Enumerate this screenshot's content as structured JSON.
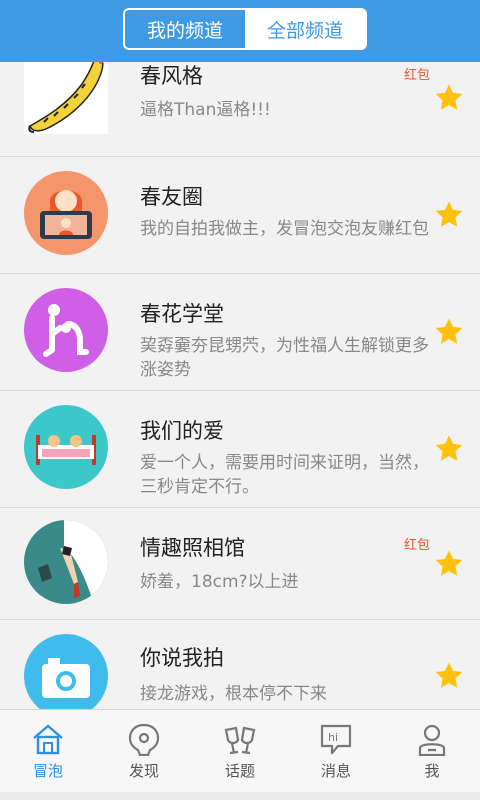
{
  "header": {
    "tabs": [
      {
        "label": "我的频道"
      },
      {
        "label": "全部频道"
      }
    ]
  },
  "channels": [
    {
      "title": "春风格",
      "desc": "逼格Than逼格!!!",
      "tag": "红包",
      "icon": "banana-image"
    },
    {
      "title": "春友圈",
      "desc": "我的自拍我做主，发冒泡交泡友赚红包",
      "tag": "",
      "icon": "selfie-icon"
    },
    {
      "title": "春花学堂",
      "desc": "巭孬嫑夯昆甥茓，为性福人生解锁更多涨姿势",
      "tag": "",
      "icon": "figure-icon"
    },
    {
      "title": "我们的爱",
      "desc": "爱一个人，需要用时间来证明，当然，三秒肯定不行。",
      "tag": "",
      "icon": "bed-icon"
    },
    {
      "title": "情趣照相馆",
      "desc": "娇羞，18cm?以上进",
      "tag": "红包",
      "icon": "legs-icon"
    },
    {
      "title": "你说我拍",
      "desc": "接龙游戏，根本停不下来",
      "tag": "",
      "icon": "camera-icon"
    }
  ],
  "tabbar": {
    "items": [
      {
        "label": "冒泡",
        "icon": "home-icon"
      },
      {
        "label": "发现",
        "icon": "discover-icon"
      },
      {
        "label": "话题",
        "icon": "cheers-icon"
      },
      {
        "label": "消息",
        "icon": "message-icon"
      },
      {
        "label": "我",
        "icon": "profile-icon"
      }
    ]
  },
  "colors": {
    "primary": "#3f9ae6",
    "tag": "#e8552f",
    "star": "#ffc10e"
  }
}
